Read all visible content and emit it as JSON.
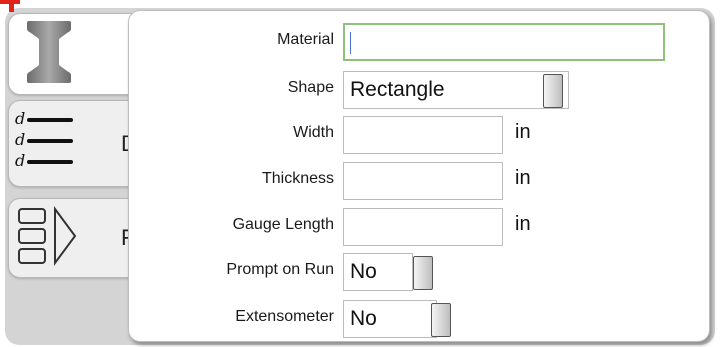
{
  "form": {
    "material": {
      "label": "Material",
      "value": ""
    },
    "shape": {
      "label": "Shape",
      "value": "Rectangle"
    },
    "width": {
      "label": "Width",
      "value": "",
      "unit": "in"
    },
    "thickness": {
      "label": "Thickness",
      "value": "",
      "unit": "in"
    },
    "gauge_length": {
      "label": "Gauge Length",
      "value": "",
      "unit": "in"
    },
    "prompt_on_run": {
      "label": "Prompt on Run",
      "value": "No"
    },
    "extensometer": {
      "label": "Extensometer",
      "value": "No"
    }
  },
  "sidebar": {
    "tabs": [
      {
        "icon": "i-beam-icon",
        "label_partial": ""
      },
      {
        "icon": "dimension-lines-icon",
        "label_partial": "D"
      },
      {
        "icon": "procedure-stack-icon",
        "label_partial": "F"
      }
    ]
  },
  "colors": {
    "accent_red": "#e2231a",
    "active_border": "#8ec27a",
    "caret": "#4d6fd0",
    "backdrop": "#d4d4d4"
  }
}
